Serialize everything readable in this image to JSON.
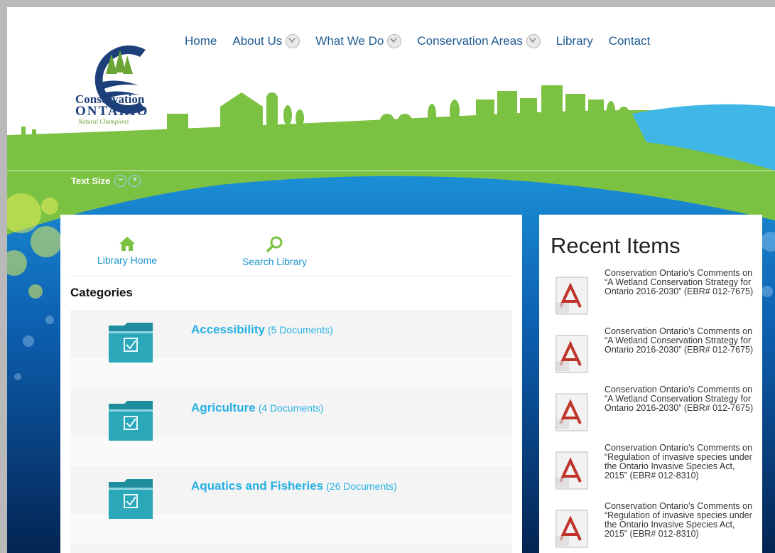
{
  "site": {
    "logo": {
      "line1": "Conservation",
      "line2": "ONTARIO",
      "tagline": "Natural Champions"
    }
  },
  "nav": {
    "items": [
      {
        "label": "Home",
        "has_dropdown": false
      },
      {
        "label": "About Us",
        "has_dropdown": true
      },
      {
        "label": "What We Do",
        "has_dropdown": true
      },
      {
        "label": "Conservation Areas",
        "has_dropdown": true
      },
      {
        "label": "Library",
        "has_dropdown": false
      },
      {
        "label": "Contact",
        "has_dropdown": false
      }
    ]
  },
  "text_size": {
    "label": "Text Size",
    "decrease": "−",
    "increase": "+"
  },
  "library": {
    "home_label": "Library Home",
    "search_label": "Search Library",
    "categories_title": "Categories",
    "categories": [
      {
        "name": "Accessibility",
        "count": "(5 Documents)"
      },
      {
        "name": "Agriculture",
        "count": "(4 Documents)"
      },
      {
        "name": "Aquatics and Fisheries",
        "count": "(26 Documents)"
      }
    ]
  },
  "sidebar": {
    "title": "Recent Items",
    "items": [
      {
        "title": "Conservation Ontario's Comments on “A Wetland Conservation Strategy for Ontario 2016-2030” (EBR# 012-7675)"
      },
      {
        "title": "Conservation Ontario's Comments on “A Wetland Conservation Strategy for Ontario 2016-2030” (EBR# 012-7675)"
      },
      {
        "title": "Conservation Ontario's Comments on “A Wetland Conservation Strategy for Ontario 2016-2030” (EBR# 012-7675)"
      },
      {
        "title": "Conservation Ontario's Comments on “Regulation of invasive species under the Ontario Invasive Species Act, 2015” (EBR# 012-8310)"
      },
      {
        "title": "Conservation Ontario's Comments on “Regulation of invasive species under the Ontario Invasive Species Act, 2015” (EBR# 012-8310)"
      }
    ]
  },
  "colors": {
    "nav_link": "#1f5a92",
    "category_link": "#26b0e4",
    "green": "#7cc242",
    "water": "#1a8fd8"
  }
}
